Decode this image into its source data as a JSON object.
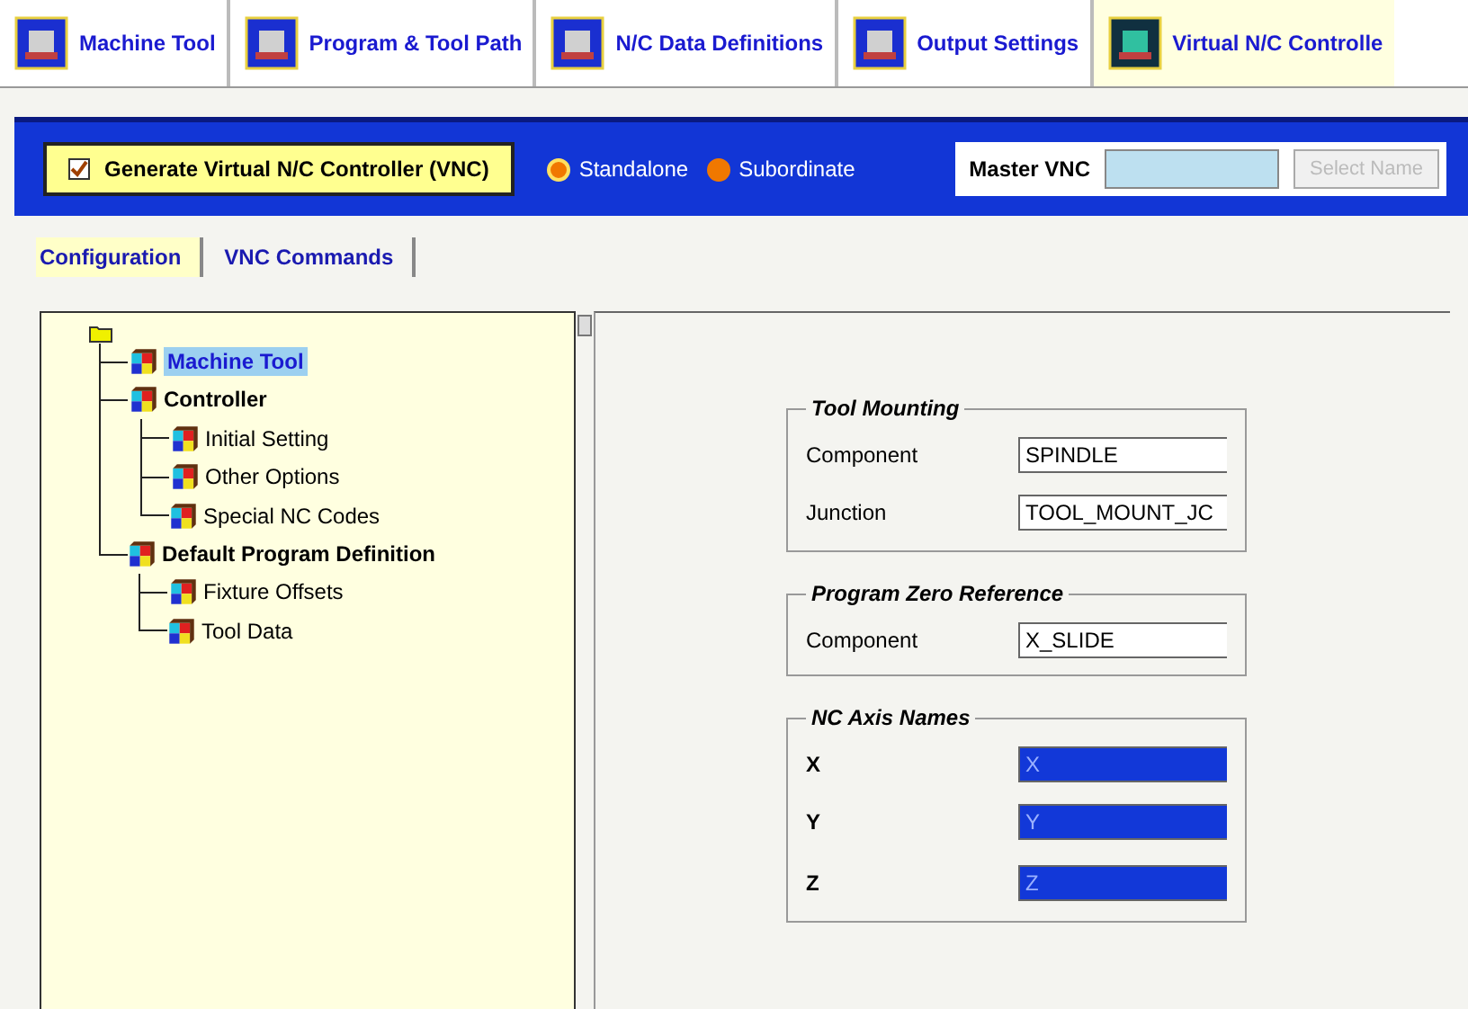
{
  "tabs": [
    {
      "label": "Machine Tool",
      "selected": false
    },
    {
      "label": "Program & Tool Path",
      "selected": false
    },
    {
      "label": "N/C Data Definitions",
      "selected": false
    },
    {
      "label": "Output Settings",
      "selected": false
    },
    {
      "label": "Virtual N/C Controlle",
      "selected": true
    }
  ],
  "vnc_bar": {
    "generate": {
      "label": "Generate Virtual N/C Controller (VNC)",
      "checked": true
    },
    "modes": [
      {
        "label": "Standalone",
        "selected": true
      },
      {
        "label": "Subordinate",
        "selected": false
      }
    ],
    "master_label": "Master VNC",
    "select_button": {
      "label": "Select Name",
      "disabled": true
    }
  },
  "subtabs": [
    {
      "label": "Configuration",
      "selected": true
    },
    {
      "label": "VNC Commands",
      "selected": false
    }
  ],
  "tree": {
    "children": [
      {
        "label": "Machine Tool",
        "selected": true
      },
      {
        "label": "Controller",
        "selected": false,
        "children": [
          {
            "label": "Initial Setting",
            "selected": false
          },
          {
            "label": "Other Options",
            "selected": false
          },
          {
            "label": "Special NC Codes",
            "selected": false
          }
        ]
      },
      {
        "label": "Default Program Definition",
        "selected": false,
        "children": [
          {
            "label": "Fixture Offsets",
            "selected": false
          },
          {
            "label": "Tool Data",
            "selected": false
          }
        ]
      }
    ]
  },
  "groups": [
    {
      "title": "Tool Mounting",
      "fields": [
        {
          "label": "Component",
          "value": "SPINDLE",
          "highlighted": false
        },
        {
          "label": "Junction",
          "value": "TOOL_MOUNT_JC",
          "highlighted": false
        }
      ]
    },
    {
      "title": "Program Zero Reference",
      "fields": [
        {
          "label": "Component",
          "value": "X_SLIDE",
          "highlighted": false
        }
      ]
    },
    {
      "title": "NC Axis Names",
      "fields": [
        {
          "label": "X",
          "value": "X",
          "highlighted": true
        },
        {
          "label": "Y",
          "value": "Y",
          "highlighted": true
        },
        {
          "label": "Z",
          "value": "Z",
          "highlighted": true
        }
      ]
    }
  ]
}
